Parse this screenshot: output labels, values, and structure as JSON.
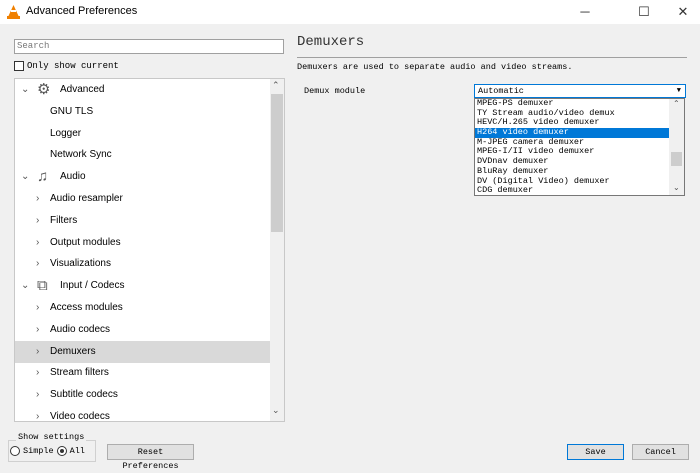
{
  "window": {
    "title": "Advanced Preferences",
    "minimize": "─",
    "maximize": "☐",
    "close": "✕"
  },
  "search": {
    "placeholder": "Search"
  },
  "only_show_current": "Only show current",
  "tree": [
    {
      "label": "Advanced",
      "level": 0,
      "expanded": true,
      "icon": "gear-icon"
    },
    {
      "label": "GNU TLS",
      "level": 1
    },
    {
      "label": "Logger",
      "level": 1
    },
    {
      "label": "Network Sync",
      "level": 1
    },
    {
      "label": "Audio",
      "level": 0,
      "expanded": true,
      "icon": "music-note-icon"
    },
    {
      "label": "Audio resampler",
      "level": 1,
      "has_children": true
    },
    {
      "label": "Filters",
      "level": 1,
      "has_children": true
    },
    {
      "label": "Output modules",
      "level": 1,
      "has_children": true
    },
    {
      "label": "Visualizations",
      "level": 1,
      "has_children": true
    },
    {
      "label": "Input / Codecs",
      "level": 0,
      "expanded": true,
      "icon": "codecs-icon"
    },
    {
      "label": "Access modules",
      "level": 1,
      "has_children": true
    },
    {
      "label": "Audio codecs",
      "level": 1,
      "has_children": true
    },
    {
      "label": "Demuxers",
      "level": 1,
      "has_children": true,
      "selected": true
    },
    {
      "label": "Stream filters",
      "level": 1,
      "has_children": true
    },
    {
      "label": "Subtitle codecs",
      "level": 1,
      "has_children": true
    },
    {
      "label": "Video codecs",
      "level": 1,
      "has_children": true
    }
  ],
  "panel": {
    "title": "Demuxers",
    "description": "Demuxers are used to separate audio and video streams.",
    "demux_label": "Demux module",
    "demux_value": "Automatic",
    "options": [
      "MPEG-PS demuxer",
      "TY Stream audio/video demux",
      "HEVC/H.265 video demuxer",
      "H264 video demuxer",
      "M-JPEG camera demuxer",
      "MPEG-I/II video demuxer",
      "DVDnav demuxer",
      "BluRay demuxer",
      "DV (Digital Video) demuxer",
      "CDG demuxer"
    ],
    "highlighted": "H264 video demuxer"
  },
  "footer": {
    "show_settings": "Show settings",
    "simple": "Simple",
    "all": "All",
    "selected": "All",
    "reset": "Reset Preferences",
    "save": "Save",
    "cancel": "Cancel"
  },
  "colors": {
    "accent": "#0078d7",
    "vlc_orange": "#f08000"
  }
}
